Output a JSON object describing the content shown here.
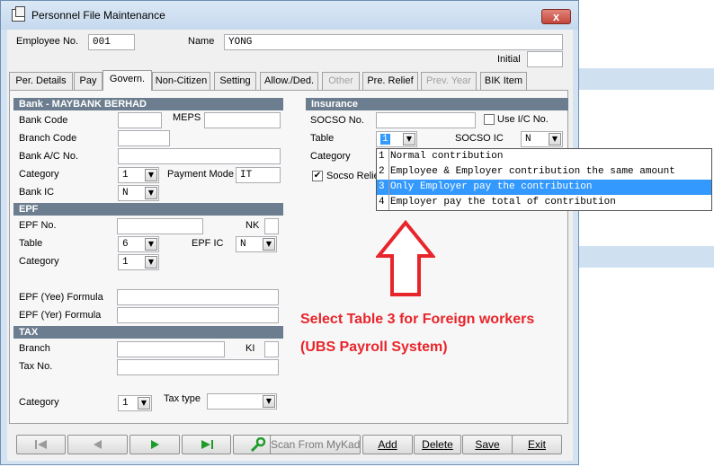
{
  "window": {
    "title": "Personnel File Maintenance",
    "close_glyph": "x"
  },
  "header": {
    "employee_no_label": "Employee No.",
    "employee_no_value": "001",
    "name_label": "Name",
    "name_value": "YONG",
    "initial_label": "Initial",
    "initial_value": ""
  },
  "tabs": [
    {
      "label": "Per. Details",
      "state": "normal"
    },
    {
      "label": "Pay",
      "state": "normal"
    },
    {
      "label": "Govern.",
      "state": "active"
    },
    {
      "label": "Non-Citizen",
      "state": "normal"
    },
    {
      "label": "Setting",
      "state": "normal"
    },
    {
      "label": "Allow./Ded.",
      "state": "normal"
    },
    {
      "label": "Other",
      "state": "disabled"
    },
    {
      "label": "Pre. Relief",
      "state": "normal"
    },
    {
      "label": "Prev. Year",
      "state": "disabled"
    },
    {
      "label": "BIK Item",
      "state": "normal"
    }
  ],
  "bank": {
    "header": "Bank - MAYBANK BERHAD",
    "bank_code_label": "Bank Code",
    "bank_code_value": "",
    "meps_label": "MEPS",
    "meps_value": "",
    "branch_code_label": "Branch Code",
    "branch_code_value": "",
    "account_label": "Bank A/C No.",
    "account_value": "",
    "category_label": "Category",
    "category_value": "1",
    "payment_mode_label": "Payment Mode",
    "payment_mode_value": "IT",
    "bank_ic_label": "Bank IC",
    "bank_ic_value": "N"
  },
  "epf": {
    "header": "EPF",
    "epf_no_label": "EPF No.",
    "epf_no_value": "",
    "nk_label": "NK",
    "nk_value": "",
    "table_label": "Table",
    "table_value": "6",
    "epf_ic_label": "EPF IC",
    "epf_ic_value": "N",
    "category_label": "Category",
    "category_value": "1",
    "yee_formula_label": "EPF (Yee) Formula",
    "yee_formula_value": "",
    "yer_formula_label": "EPF (Yer) Formula",
    "yer_formula_value": ""
  },
  "tax": {
    "header": "TAX",
    "branch_label": "Branch",
    "branch_value": "",
    "ki_label": "KI",
    "ki_value": "",
    "tax_no_label": "Tax No.",
    "tax_no_value": "",
    "category_label": "Category",
    "category_value": "1",
    "tax_type_label": "Tax type",
    "tax_type_value": ""
  },
  "insurance": {
    "header": "Insurance",
    "socso_no_label": "SOCSO No.",
    "socso_no_value": "",
    "use_ic_label": "Use I/C No.",
    "use_ic_checked": false,
    "table_label": "Table",
    "table_value": "1",
    "socso_ic_label": "SOCSO IC",
    "socso_ic_value": "N",
    "category_label": "Category",
    "socso_relief_label": "Socso Relie",
    "socso_relief_checked": true
  },
  "dropdown_options": [
    {
      "num": "1",
      "text": "Normal contribution"
    },
    {
      "num": "2",
      "text": "Employee & Employer contribution the same amount"
    },
    {
      "num": "3",
      "text": "Only Employer pay the contribution"
    },
    {
      "num": "4",
      "text": "Employer pay the total of contribution"
    }
  ],
  "dropdown_selected_index": 2,
  "annotation": {
    "line1": "Select Table 3 for Foreign workers",
    "line2": "(UBS Payroll System)",
    "color": "#e8252b"
  },
  "buttons": {
    "first": "|◀",
    "prev": "◀",
    "next": "▶",
    "last": "▶|",
    "search": "search",
    "scan": "Scan From MyKad",
    "add": "Add",
    "delete": "Delete",
    "save": "Save",
    "exit": "Exit"
  },
  "colors": {
    "section_header": "#6b7d8e",
    "selection": "#3399ff",
    "nav_green": "#1e9c2a",
    "nav_gray": "#9a9a9a"
  }
}
